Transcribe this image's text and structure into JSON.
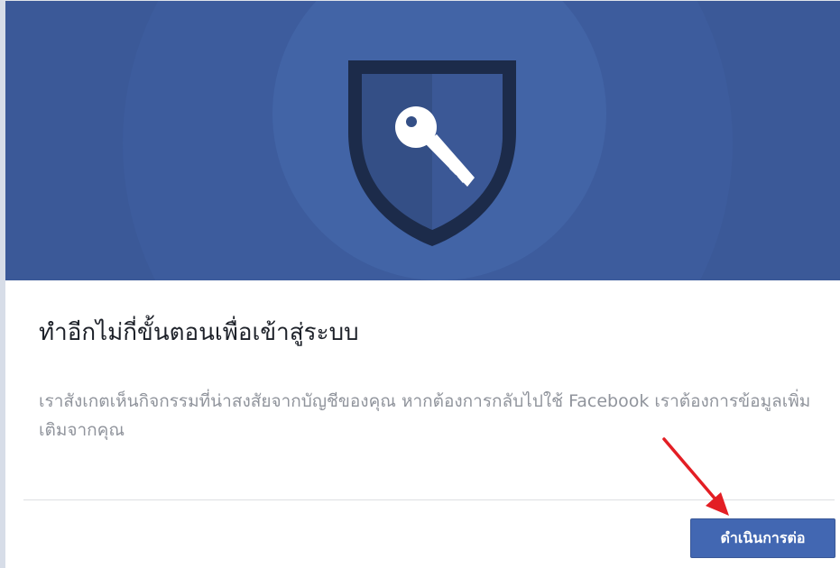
{
  "dialog": {
    "title": "ทำอีกไม่กี่ขั้นตอนเพื่อเข้าสู่ระบบ",
    "message": "เราสังเกตเห็นกิจกรรมที่น่าสงสัยจากบัญชีของคุณ หากต้องการกลับไปใช้ Facebook เราต้องการข้อมูลเพิ่มเติมจากคุณ",
    "continue_label": "ดำเนินการต่อ"
  },
  "hero": {
    "icon": "shield-key-icon",
    "background_color": "#3b5998"
  },
  "annotation": {
    "icon": "red-arrow-icon",
    "color": "#e31e24"
  },
  "colors": {
    "button": "#4267b2",
    "title_text": "#1d2129",
    "body_text": "#90949c"
  }
}
